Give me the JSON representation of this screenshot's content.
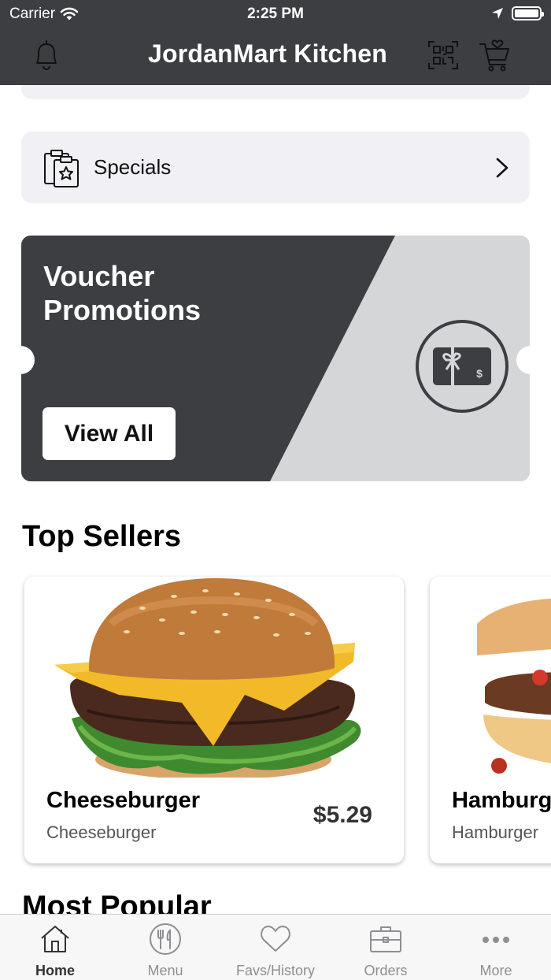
{
  "status_bar": {
    "carrier": "Carrier",
    "time": "2:25 PM"
  },
  "header": {
    "title": "JordanMart Kitchen",
    "left_icon": "bell-icon",
    "right_icons": [
      "qr-code-icon",
      "cart-heart-icon"
    ]
  },
  "specials": {
    "label": "Specials",
    "icon": "clipboard-star-icon"
  },
  "voucher": {
    "title": "Voucher Promotions",
    "button_label": "View All",
    "icon": "gift-card-icon"
  },
  "top_sellers": {
    "title": "Top Sellers",
    "items": [
      {
        "name": "Cheeseburger",
        "subtitle": "Cheeseburger",
        "price": "$5.29"
      },
      {
        "name": "Hamburger",
        "subtitle": "Hamburger",
        "price": ""
      }
    ]
  },
  "next_section_title": "Most Popular",
  "tabbar": {
    "active": "Home",
    "tabs": [
      {
        "label": "Home",
        "icon": "home-icon"
      },
      {
        "label": "Menu",
        "icon": "utensils-icon"
      },
      {
        "label": "Favs/History",
        "icon": "heart-icon"
      },
      {
        "label": "Orders",
        "icon": "briefcase-icon"
      },
      {
        "label": "More",
        "icon": "more-dots-icon"
      }
    ]
  },
  "colors": {
    "header_bg": "#3d3e42",
    "card_bg": "#f1f1f5",
    "voucher_light": "#d5d6d8"
  }
}
